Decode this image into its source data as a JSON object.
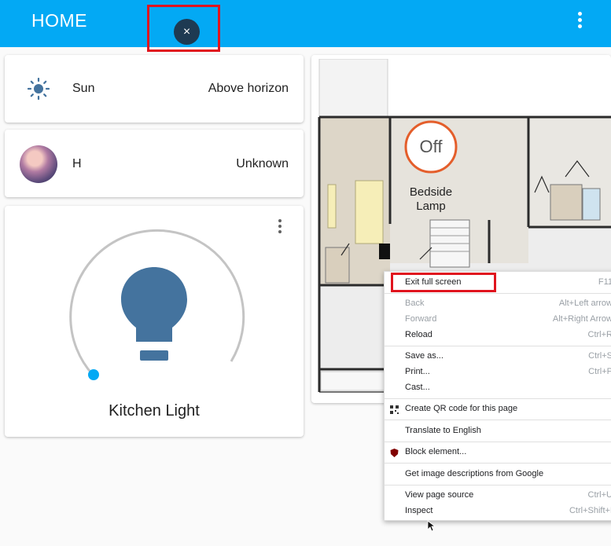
{
  "app": {
    "title": "HOME"
  },
  "header": {
    "close_label": "×"
  },
  "entities": [
    {
      "name": "Sun",
      "state": "Above horizon",
      "icon": "sun-icon"
    },
    {
      "name": "H",
      "state": "Unknown",
      "icon": "avatar"
    }
  ],
  "light": {
    "name": "Kitchen Light",
    "icon": "lightbulb-icon",
    "brightness_level": 0
  },
  "floorplan": {
    "lamp_state": "Off",
    "lamp_name_line1": "Bedside",
    "lamp_name_line2": "Lamp"
  },
  "context_menu": {
    "exit_fullscreen": {
      "label": "Exit full screen",
      "shortcut": "F11"
    },
    "back": {
      "label": "Back",
      "shortcut": "Alt+Left arrow"
    },
    "forward": {
      "label": "Forward",
      "shortcut": "Alt+Right Arrow"
    },
    "reload": {
      "label": "Reload",
      "shortcut": "Ctrl+R"
    },
    "save_as": {
      "label": "Save as...",
      "shortcut": "Ctrl+S"
    },
    "print": {
      "label": "Print...",
      "shortcut": "Ctrl+P"
    },
    "cast": {
      "label": "Cast..."
    },
    "qr": {
      "label": "Create QR code for this page"
    },
    "translate": {
      "label": "Translate to English"
    },
    "block": {
      "label": "Block element..."
    },
    "image_desc": {
      "label": "Get image descriptions from Google"
    },
    "view_source": {
      "label": "View page source",
      "shortcut": "Ctrl+U"
    },
    "inspect": {
      "label": "Inspect",
      "shortcut": "Ctrl+Shift+I"
    }
  },
  "colors": {
    "header": "#03a9f4",
    "accent_red": "#e0141e",
    "bulb": "#44739e",
    "lamp_ring": "#e45e2b"
  }
}
